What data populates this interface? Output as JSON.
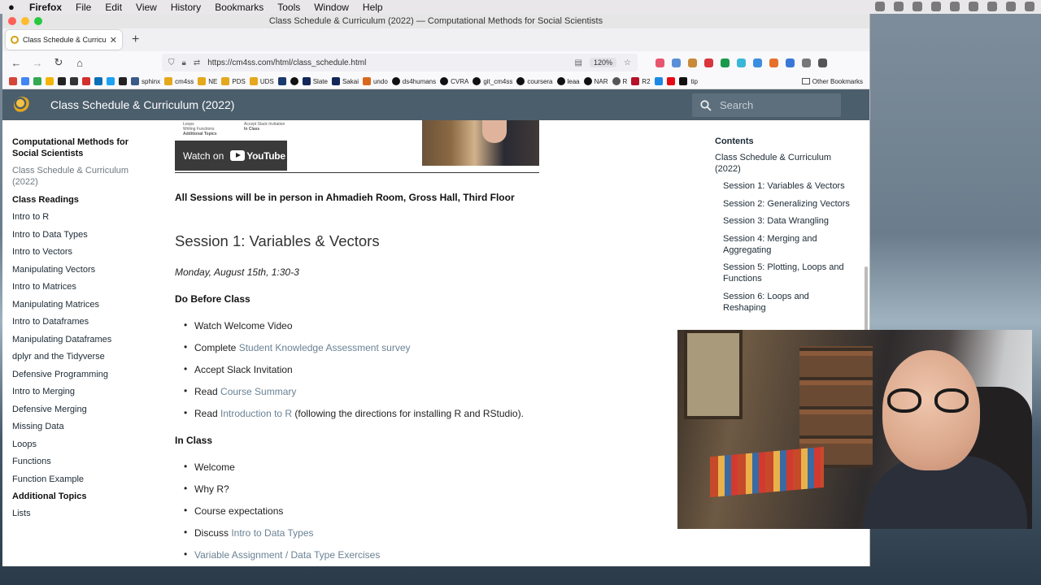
{
  "menubar": {
    "app": "Firefox",
    "items": [
      "File",
      "Edit",
      "View",
      "History",
      "Bookmarks",
      "Tools",
      "Window",
      "Help"
    ]
  },
  "window": {
    "title": "Class Schedule & Curriculum (2022) — Computational Methods for Social Scientists"
  },
  "tab": {
    "title": "Class Schedule & Curriculum (2"
  },
  "navbar": {
    "url": "https://cm4ss.com/html/class_schedule.html",
    "zoom": "120%"
  },
  "bookmarks": {
    "items": [
      "sphinx",
      "cm4ss",
      "NE",
      "PDS",
      "UDS",
      "Slate",
      "Sakai",
      "undo",
      "ds4humans",
      "CVRA",
      "git_cm4ss",
      "coursera",
      "leaa",
      "NAR",
      "R",
      "R2",
      "tip"
    ],
    "other": "Other Bookmarks"
  },
  "site": {
    "title": "Class Schedule & Curriculum (2022)",
    "search_placeholder": "Search"
  },
  "leftnav": {
    "section_title": "Computational Methods for Social Scientists",
    "current": "Class Schedule & Curriculum (2022)",
    "readings_title": "Class Readings",
    "readings": [
      "Intro to R",
      "Intro to Data Types",
      "Intro to Vectors",
      "Manipulating Vectors",
      "Intro to Matrices",
      "Manipulating Matrices",
      "Intro to Dataframes",
      "Manipulating Dataframes",
      "dplyr and the Tidyverse",
      "Defensive Programming",
      "Intro to Merging",
      "Defensive Merging",
      "Missing Data",
      "Loops",
      "Functions",
      "Function Example"
    ],
    "additional_title": "Additional Topics",
    "additional": [
      "Lists"
    ]
  },
  "video": {
    "watch_on": "Watch on",
    "youtube": "YouTube",
    "thumb_lines_left": [
      "Loops",
      "Writing Functions",
      "Additional Topics"
    ],
    "thumb_lines_right": [
      "Accept Slack Invitation",
      "In Class"
    ]
  },
  "main": {
    "sessions_note": "All Sessions will be in person in Ahmadieh Room, Gross Hall, Third Floor",
    "session_heading": "Session 1: Variables & Vectors",
    "session_date": "Monday, August 15th, 1:30-3",
    "before_title": "Do Before Class",
    "before_items": [
      {
        "pre": "Watch Welcome Video",
        "link": "",
        "post": ""
      },
      {
        "pre": "Complete ",
        "link": "Student Knowledge Assessment survey",
        "post": ""
      },
      {
        "pre": "Accept Slack Invitation",
        "link": "",
        "post": ""
      },
      {
        "pre": "Read ",
        "link": "Course Summary",
        "post": ""
      },
      {
        "pre": "Read ",
        "link": "Introduction to R",
        "post": " (following the directions for installing R and RStudio)."
      }
    ],
    "inclass_title": "In Class",
    "inclass_items": [
      {
        "pre": "Welcome",
        "link": "",
        "post": ""
      },
      {
        "pre": "Why R?",
        "link": "",
        "post": ""
      },
      {
        "pre": "Course expectations",
        "link": "",
        "post": ""
      },
      {
        "pre": "Discuss ",
        "link": "Intro to Data Types",
        "post": ""
      },
      {
        "pre": "",
        "link": "Variable Assignment / Data Type Exercises",
        "post": ""
      }
    ]
  },
  "toc": {
    "title": "Contents",
    "root": "Class Schedule & Curriculum (2022)",
    "items": [
      "Session 1: Variables & Vectors",
      "Session 2: Generalizing Vectors",
      "Session 3: Data Wrangling",
      "Session 4: Merging and Aggregating",
      "Session 5: Plotting, Loops and Functions",
      "Session 6: Loops and Reshaping"
    ]
  },
  "colors": {
    "header_bg": "#4b5e6c",
    "link": "#6a8294"
  }
}
